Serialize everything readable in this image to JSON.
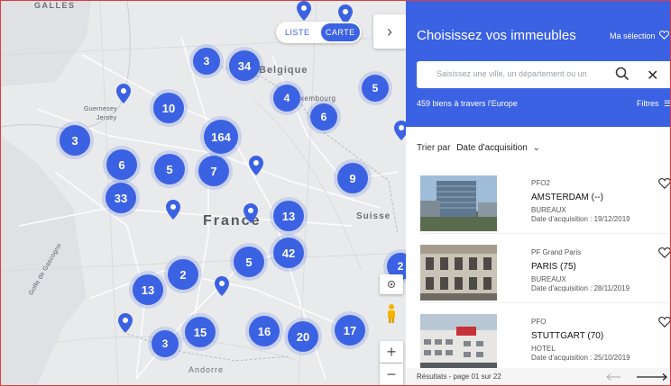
{
  "map": {
    "places": [
      "GALLES",
      "Belgique",
      "Guernesey",
      "Jersey",
      "Luxembourg",
      "France",
      "Suisse",
      "Andorre",
      "Golfe de Gascogne"
    ],
    "toggle": {
      "list_label": "LISTE",
      "map_label": "CARTE",
      "selected": "CARTE"
    },
    "clusters": [
      "3",
      "34",
      "5",
      "10",
      "4",
      "6",
      "3",
      "164",
      "6",
      "5",
      "7",
      "9",
      "33",
      "13",
      "42",
      "5",
      "2",
      "13",
      "2",
      "15",
      "16",
      "20",
      "17",
      "3"
    ],
    "pin_icon": "location-pin-icon",
    "controls": {
      "zoom_in": "+",
      "zoom_out": "−"
    }
  },
  "panel": {
    "title": "Choisissez vos immeubles",
    "my_selection": "Ma sélection",
    "search_placeholder": "Saisissez une ville, un département ou un",
    "count_text": "459 biens à travers l'Europe",
    "filters_label": "Filtres",
    "sort_label": "Trier par",
    "sort_value": "Date d'acquisition",
    "items": [
      {
        "fund": "PFO2",
        "city": "AMSTERDAM (--)",
        "type": "BUREAUX",
        "date": "Date d'acquisition : 19/12/2019"
      },
      {
        "fund": "PF Grand Paris",
        "city": "PARIS (75)",
        "type": "BUREAUX",
        "date": "Date d'acquisition : 28/11/2019"
      },
      {
        "fund": "PFO",
        "city": "STUTTGART (70)",
        "type": "HOTEL",
        "date": "Date d'acquisition : 25/10/2019"
      }
    ],
    "pagination": "Résultats - page 01 sur 22",
    "accent_color": "#3b62e3"
  }
}
